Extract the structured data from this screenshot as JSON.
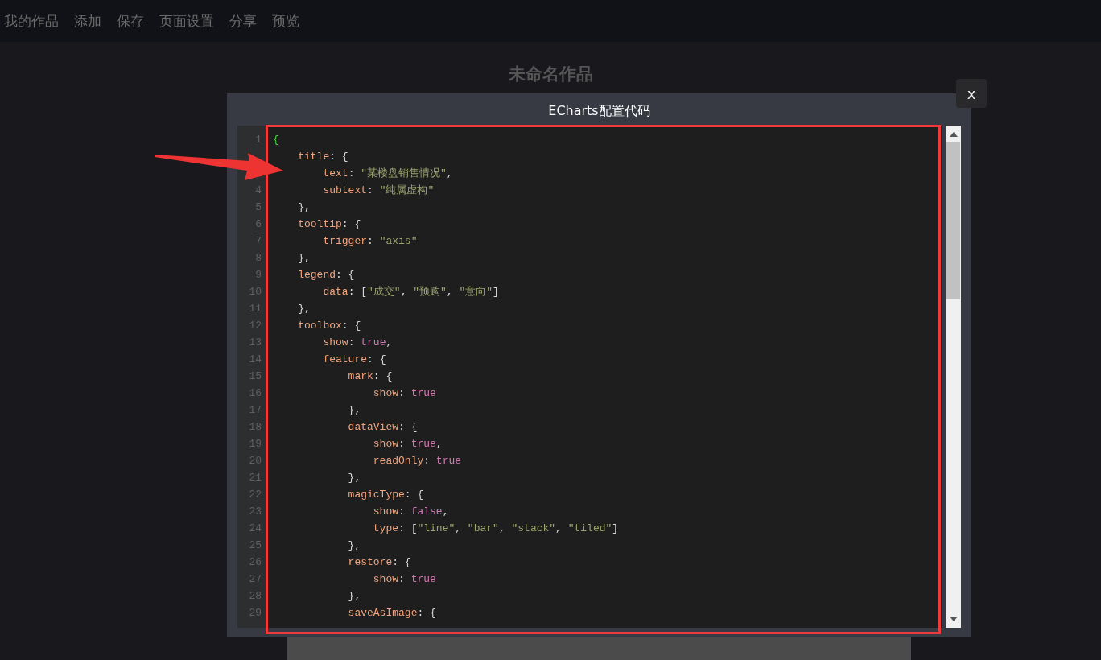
{
  "menu": [
    {
      "label": "我的作品"
    },
    {
      "label": "添加"
    },
    {
      "label": "保存"
    },
    {
      "label": "页面设置"
    },
    {
      "label": "分享"
    },
    {
      "label": "预览"
    }
  ],
  "work_title": "未命名作品",
  "close_button": "x",
  "dialog": {
    "title": "ECharts配置代码",
    "code_lines": [
      {
        "number": "1",
        "segments": [
          {
            "kind": "brace",
            "text": "{"
          }
        ]
      },
      {
        "segments": [
          {
            "kind": "key",
            "text": "    title"
          },
          {
            "kind": "punct",
            "text": ": {"
          }
        ]
      },
      {
        "segments": [
          {
            "kind": "key",
            "text": "        text"
          },
          {
            "kind": "punct",
            "text": ": "
          },
          {
            "kind": "string",
            "text": "\"某楼盘销售情况\""
          },
          {
            "kind": "punct",
            "text": ","
          }
        ]
      },
      {
        "number": "4",
        "segments": [
          {
            "kind": "key",
            "text": "        subtext"
          },
          {
            "kind": "punct",
            "text": ": "
          },
          {
            "kind": "string",
            "text": "\"纯属虚构\""
          }
        ]
      },
      {
        "number": "5",
        "segments": [
          {
            "kind": "punct",
            "text": "    },"
          }
        ]
      },
      {
        "number": "6",
        "segments": [
          {
            "kind": "key",
            "text": "    tooltip"
          },
          {
            "kind": "punct",
            "text": ": {"
          }
        ]
      },
      {
        "number": "7",
        "segments": [
          {
            "kind": "key",
            "text": "        trigger"
          },
          {
            "kind": "punct",
            "text": ": "
          },
          {
            "kind": "string",
            "text": "\"axis\""
          }
        ]
      },
      {
        "number": "8",
        "segments": [
          {
            "kind": "punct",
            "text": "    },"
          }
        ]
      },
      {
        "number": "9",
        "segments": [
          {
            "kind": "key",
            "text": "    legend"
          },
          {
            "kind": "punct",
            "text": ": {"
          }
        ]
      },
      {
        "number": "10",
        "segments": [
          {
            "kind": "key",
            "text": "        data"
          },
          {
            "kind": "punct",
            "text": ": ["
          },
          {
            "kind": "string",
            "text": "\"成交\""
          },
          {
            "kind": "punct",
            "text": ", "
          },
          {
            "kind": "string",
            "text": "\"预购\""
          },
          {
            "kind": "punct",
            "text": ", "
          },
          {
            "kind": "string",
            "text": "\"意向\""
          },
          {
            "kind": "punct",
            "text": "]"
          }
        ]
      },
      {
        "number": "11",
        "segments": [
          {
            "kind": "punct",
            "text": "    },"
          }
        ]
      },
      {
        "number": "12",
        "segments": [
          {
            "kind": "key",
            "text": "    toolbox"
          },
          {
            "kind": "punct",
            "text": ": {"
          }
        ]
      },
      {
        "number": "13",
        "segments": [
          {
            "kind": "key",
            "text": "        show"
          },
          {
            "kind": "punct",
            "text": ": "
          },
          {
            "kind": "bool",
            "text": "true"
          },
          {
            "kind": "punct",
            "text": ","
          }
        ]
      },
      {
        "number": "14",
        "segments": [
          {
            "kind": "key",
            "text": "        feature"
          },
          {
            "kind": "punct",
            "text": ": {"
          }
        ]
      },
      {
        "number": "15",
        "segments": [
          {
            "kind": "key",
            "text": "            mark"
          },
          {
            "kind": "punct",
            "text": ": {"
          }
        ]
      },
      {
        "number": "16",
        "segments": [
          {
            "kind": "key",
            "text": "                show"
          },
          {
            "kind": "punct",
            "text": ": "
          },
          {
            "kind": "bool",
            "text": "true"
          }
        ]
      },
      {
        "number": "17",
        "segments": [
          {
            "kind": "punct",
            "text": "            },"
          }
        ]
      },
      {
        "number": "18",
        "segments": [
          {
            "kind": "key",
            "text": "            dataView"
          },
          {
            "kind": "punct",
            "text": ": {"
          }
        ]
      },
      {
        "number": "19",
        "segments": [
          {
            "kind": "key",
            "text": "                show"
          },
          {
            "kind": "punct",
            "text": ": "
          },
          {
            "kind": "bool",
            "text": "true"
          },
          {
            "kind": "punct",
            "text": ","
          }
        ]
      },
      {
        "number": "20",
        "segments": [
          {
            "kind": "key",
            "text": "                readOnly"
          },
          {
            "kind": "punct",
            "text": ": "
          },
          {
            "kind": "bool",
            "text": "true"
          }
        ]
      },
      {
        "number": "21",
        "segments": [
          {
            "kind": "punct",
            "text": "            },"
          }
        ]
      },
      {
        "number": "22",
        "segments": [
          {
            "kind": "key",
            "text": "            magicType"
          },
          {
            "kind": "punct",
            "text": ": {"
          }
        ]
      },
      {
        "number": "23",
        "segments": [
          {
            "kind": "key",
            "text": "                show"
          },
          {
            "kind": "punct",
            "text": ": "
          },
          {
            "kind": "bool",
            "text": "false"
          },
          {
            "kind": "punct",
            "text": ","
          }
        ]
      },
      {
        "number": "24",
        "segments": [
          {
            "kind": "key",
            "text": "                type"
          },
          {
            "kind": "punct",
            "text": ": ["
          },
          {
            "kind": "string",
            "text": "\"line\""
          },
          {
            "kind": "punct",
            "text": ", "
          },
          {
            "kind": "string",
            "text": "\"bar\""
          },
          {
            "kind": "punct",
            "text": ", "
          },
          {
            "kind": "string",
            "text": "\"stack\""
          },
          {
            "kind": "punct",
            "text": ", "
          },
          {
            "kind": "string",
            "text": "\"tiled\""
          },
          {
            "kind": "punct",
            "text": "]"
          }
        ]
      },
      {
        "number": "25",
        "segments": [
          {
            "kind": "punct",
            "text": "            },"
          }
        ]
      },
      {
        "number": "26",
        "segments": [
          {
            "kind": "key",
            "text": "            restore"
          },
          {
            "kind": "punct",
            "text": ": {"
          }
        ]
      },
      {
        "number": "27",
        "segments": [
          {
            "kind": "key",
            "text": "                show"
          },
          {
            "kind": "punct",
            "text": ": "
          },
          {
            "kind": "bool",
            "text": "true"
          }
        ]
      },
      {
        "number": "28",
        "segments": [
          {
            "kind": "punct",
            "text": "            },"
          }
        ]
      },
      {
        "number": "29",
        "segments": [
          {
            "kind": "key",
            "text": "            saveAsImage"
          },
          {
            "kind": "punct",
            "text": ": {"
          }
        ]
      }
    ]
  }
}
